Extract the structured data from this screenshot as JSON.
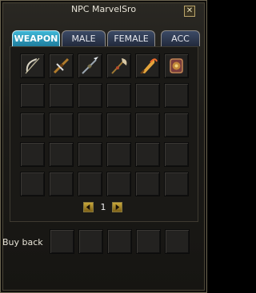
{
  "window": {
    "title": "NPC MarvelSro",
    "close_glyph": "✕"
  },
  "tabs": [
    {
      "label": "WEAPON",
      "active": true
    },
    {
      "label": "MALE",
      "active": false
    },
    {
      "label": "FEMALE",
      "active": false
    },
    {
      "label": "ACC",
      "active": false
    }
  ],
  "grid": {
    "columns": 6,
    "rows": 5,
    "items": [
      {
        "icon": "bow-icon"
      },
      {
        "icon": "crossbow-icon"
      },
      {
        "icon": "spear-icon"
      },
      {
        "icon": "glaive-icon"
      },
      {
        "icon": "flame-blade-icon"
      },
      {
        "icon": "tower-shield-icon"
      }
    ]
  },
  "pager": {
    "page": "1",
    "prev_icon": "arrow-left-icon",
    "next_icon": "arrow-right-icon"
  },
  "buy_back": {
    "label": "Buy back",
    "slots": 5
  }
}
